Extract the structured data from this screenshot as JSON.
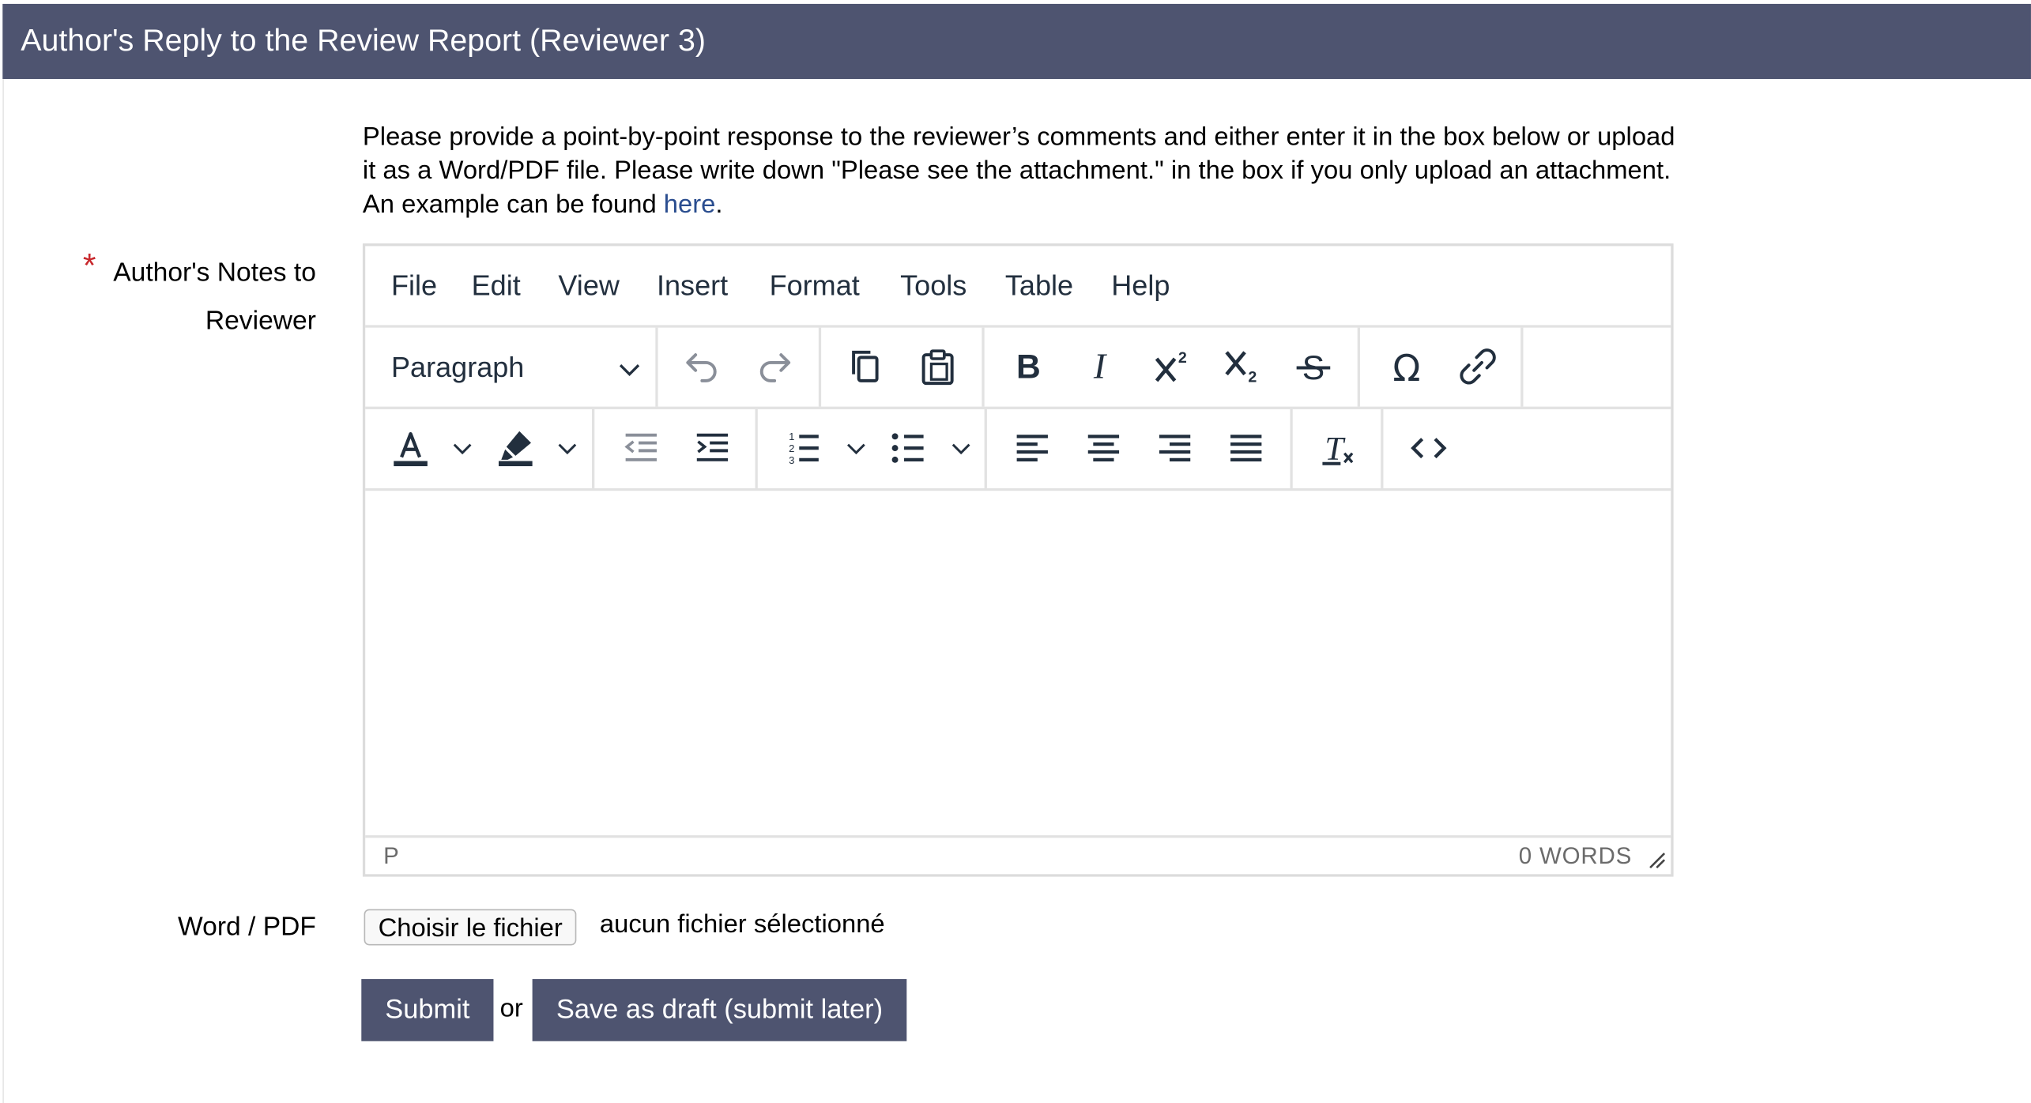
{
  "header": {
    "title": "Author's Reply to the Review Report (Reviewer 3)"
  },
  "intro": {
    "text": "Please provide a point-by-point response to the reviewer’s comments and either enter it in the box below or upload it as a Word/PDF file. Please write down \"Please see the attachment.\" in the box if you only upload an attachment. An example can be found ",
    "link_text": "here",
    "suffix": "."
  },
  "form": {
    "required_marker": "*",
    "notes_label_line1": "Author's Notes to",
    "notes_label_line2": "Reviewer",
    "file_label": "Word / PDF",
    "file_button": "Choisir le fichier",
    "file_status": "aucun fichier sélectionné"
  },
  "editor": {
    "menu": [
      "File",
      "Edit",
      "View",
      "Insert",
      "Format",
      "Tools",
      "Table",
      "Help"
    ],
    "block_format": "Paragraph",
    "content": "",
    "status_path": "P",
    "word_count": "0 WORDS",
    "toolbar_icons": [
      "undo-icon",
      "redo-icon",
      "copy-icon",
      "paste-icon",
      "bold-icon",
      "italic-icon",
      "superscript-icon",
      "subscript-icon",
      "strikethrough-icon",
      "special-char-icon",
      "link-icon",
      "text-color-icon",
      "highlight-icon",
      "outdent-icon",
      "indent-icon",
      "numbered-list-icon",
      "bullet-list-icon",
      "align-left-icon",
      "align-center-icon",
      "align-right-icon",
      "justify-icon",
      "clear-format-icon",
      "code-icon"
    ]
  },
  "actions": {
    "submit": "Submit",
    "or": "or",
    "save_draft": "Save as draft (submit later)"
  },
  "colors": {
    "header_bg": "#4e5470",
    "required": "#c8282c",
    "link": "#2a4d8f"
  }
}
